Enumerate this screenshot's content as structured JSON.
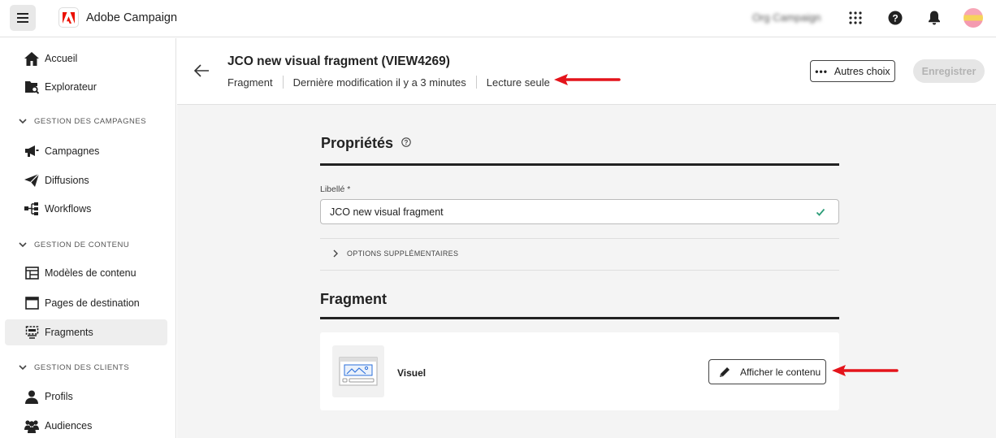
{
  "app": {
    "name": "Adobe Campaign",
    "org": "Org Campaign"
  },
  "sidebar": {
    "items": [
      {
        "label": "Accueil",
        "icon": "home-icon"
      },
      {
        "label": "Explorateur",
        "icon": "explorer-icon"
      }
    ],
    "sections": [
      {
        "title": "GESTION DES CAMPAGNES",
        "items": [
          {
            "label": "Campagnes",
            "icon": "megaphone-icon"
          },
          {
            "label": "Diffusions",
            "icon": "send-icon"
          },
          {
            "label": "Workflows",
            "icon": "workflow-icon"
          }
        ]
      },
      {
        "title": "GESTION DE CONTENU",
        "items": [
          {
            "label": "Modèles de contenu",
            "icon": "template-icon"
          },
          {
            "label": "Pages de destination",
            "icon": "landing-page-icon"
          },
          {
            "label": "Fragments",
            "icon": "fragment-icon",
            "active": true
          }
        ]
      },
      {
        "title": "GESTION DES CLIENTS",
        "items": [
          {
            "label": "Profils",
            "icon": "profile-icon"
          },
          {
            "label": "Audiences",
            "icon": "audiences-icon"
          }
        ]
      }
    ]
  },
  "header": {
    "title": "JCO new visual fragment (VIEW4269)",
    "meta": [
      "Fragment",
      "Dernière modification il y a 3 minutes",
      "Lecture seule"
    ],
    "more_label": "Autres choix",
    "save_label": "Enregistrer"
  },
  "properties": {
    "title": "Propriétés",
    "label_field": "Libellé *",
    "label_value": "JCO new visual fragment",
    "options_label": "OPTIONS SUPPLÉMENTAIRES"
  },
  "fragment": {
    "title": "Fragment",
    "type_label": "Visuel",
    "show_content_label": "Afficher le contenu"
  },
  "colors": {
    "accent_red": "#eb1000",
    "annotation_red": "#e4141b",
    "check_green": "#2d9d78"
  }
}
